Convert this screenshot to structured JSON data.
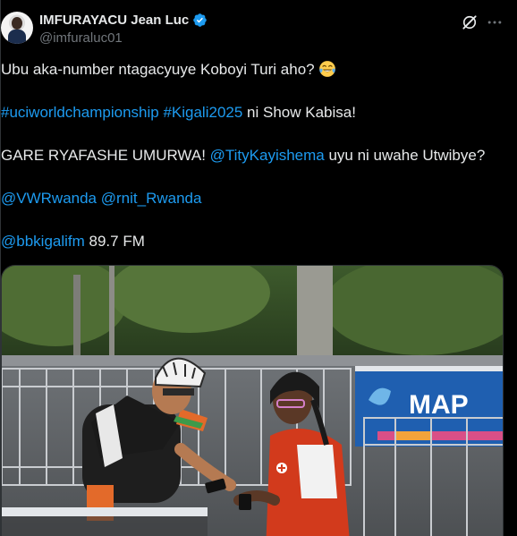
{
  "author": {
    "display_name": "IMFURAYACU Jean Luc",
    "handle": "@imfuraluc01",
    "verified": true,
    "avatar_icon": "profile-photo"
  },
  "actions": {
    "grok_icon": "grok-icon",
    "more_icon": "more-options-icon"
  },
  "tweet": {
    "line1": "Ubu aka-number ntagacyuye Koboyi Turi aho?",
    "line1_emoji": "face-with-tears-of-joy",
    "hashtag1": "#uciworldchampionship",
    "hashtag2": "#Kigali2025",
    "line2_rest": " ni Show Kabisa!",
    "line3_start": "GARE RYAFASHE UMURWA! ",
    "mention1": "@TityKayishema",
    "line3_rest": " uyu ni uwahe Utwibye?",
    "mention2": "@VWRwanda",
    "mention3": "@rnit_Rwanda",
    "mention4": "@bbkigalifm",
    "line5_rest": " 89.7 FM"
  },
  "media": {
    "banner_text": "MAP",
    "description_icon": "photo-media"
  },
  "colors": {
    "background": "#000000",
    "text": "#e7e9ea",
    "secondary_text": "#71767b",
    "link": "#1d9bf0",
    "verified_badge": "#1d9bf0"
  }
}
